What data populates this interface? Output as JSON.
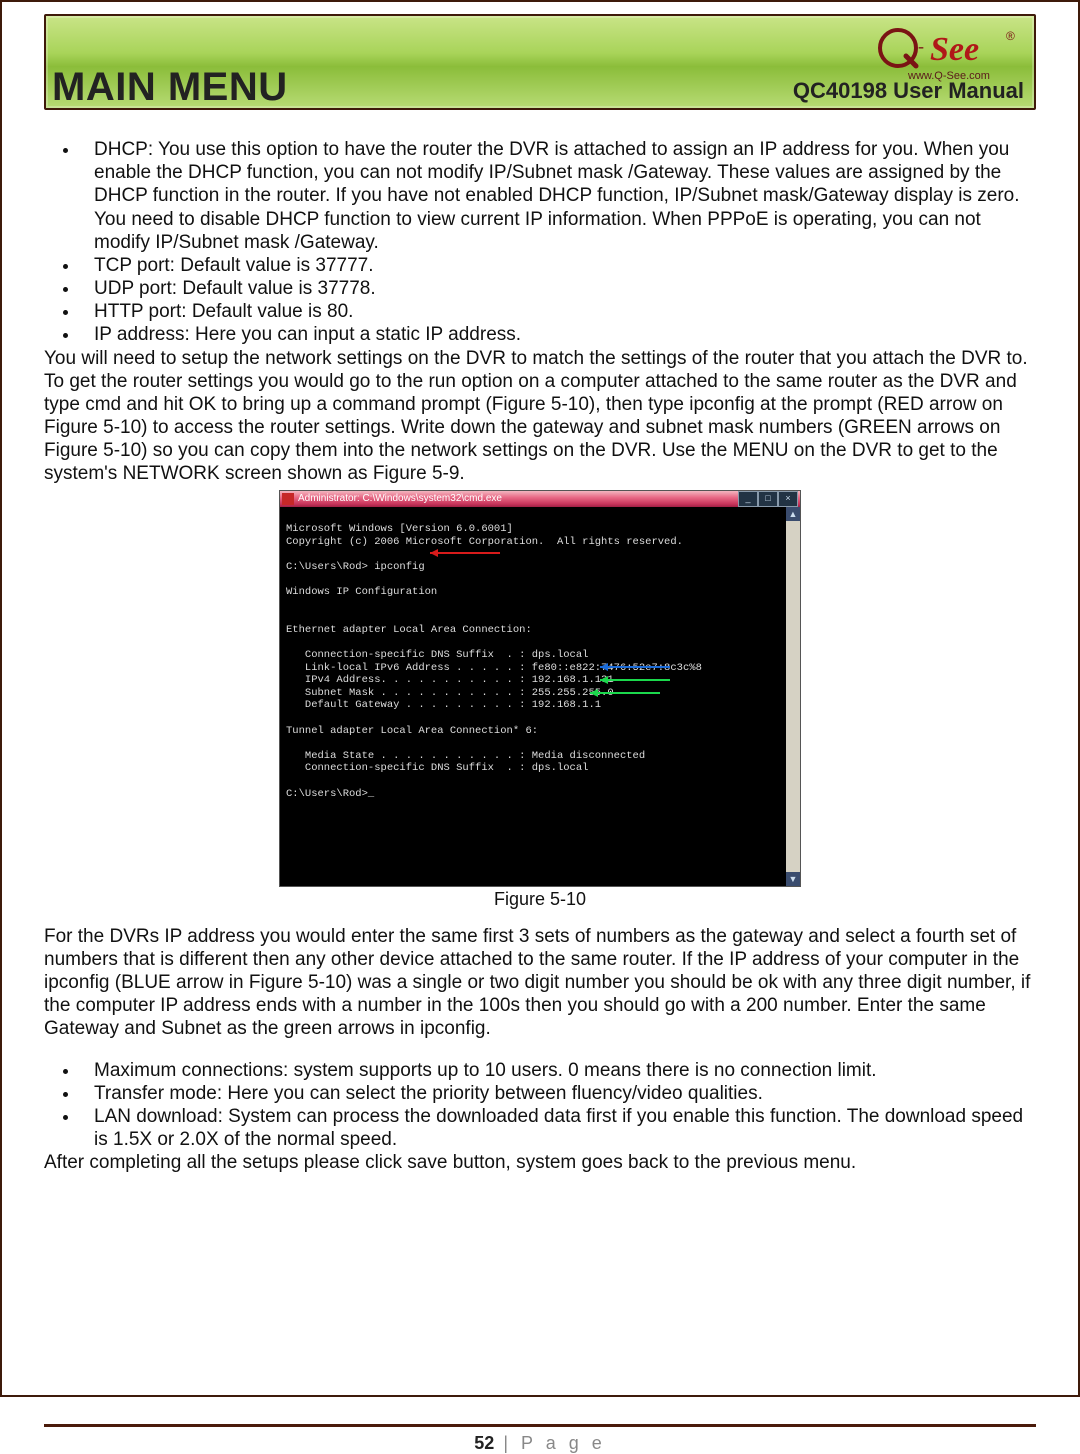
{
  "header": {
    "main_title": "MAIN MENU",
    "subtitle": "QC40198 User Manual",
    "logo_text": "Q-See",
    "logo_url": "www.Q-See.com"
  },
  "bullets1": [
    "DHCP: You use this option to have the router the DVR is attached to assign an IP address for you. When you enable the DHCP function, you can not modify IP/Subnet mask /Gateway. These values are assigned by the DHCP function in the router. If you have not enabled DHCP function, IP/Subnet mask/Gateway display is zero. You need to disable DHCP function to view current IP information.  When PPPoE is operating, you can not modify IP/Subnet mask /Gateway.",
    "TCP port: Default value is 37777.",
    "UDP port: Default value is 37778.",
    "HTTP port: Default value is 80.",
    "IP address: Here you can input a static IP address."
  ],
  "para1": "You will need to setup the network settings on the DVR to match the settings of the router that you attach the DVR to. To get the router settings you would go to the run option on a computer attached to the same router as the DVR and type cmd and hit OK to bring up a command prompt (Figure 5-10), then type ipconfig at the prompt (RED arrow on Figure 5-10) to access the router settings. Write down the gateway and subnet mask numbers (GREEN arrows on Figure 5-10) so you can copy them into the network settings on the DVR. Use the MENU on the DVR to get to the system's NETWORK screen shown as Figure 5-9.",
  "cmd": {
    "title": "Administrator: C:\\Windows\\system32\\cmd.exe",
    "lines": [
      "Microsoft Windows [Version 6.0.6001]",
      "Copyright (c) 2006 Microsoft Corporation.  All rights reserved.",
      "",
      "C:\\Users\\Rod> ipconfig",
      "",
      "Windows IP Configuration",
      "",
      "",
      "Ethernet adapter Local Area Connection:",
      "",
      "   Connection-specific DNS Suffix  . : dps.local",
      "   Link-local IPv6 Address . . . . . : fe80::e822:7476:52e7:8c3c%8",
      "   IPv4 Address. . . . . . . . . . . : 192.168.1.131",
      "   Subnet Mask . . . . . . . . . . . : 255.255.255.0",
      "   Default Gateway . . . . . . . . . : 192.168.1.1",
      "",
      "Tunnel adapter Local Area Connection* 6:",
      "",
      "   Media State . . . . . . . . . . . : Media disconnected",
      "   Connection-specific DNS Suffix  . : dps.local",
      "",
      "C:\\Users\\Rod>_"
    ]
  },
  "figure_caption": "Figure 5-10",
  "para2": "For the DVRs IP address you would enter the same first 3 sets of numbers as the gateway and select a fourth set of numbers that is different then any other device attached to the same router. If the IP address of your computer in the ipconfig (BLUE arrow in Figure 5-10) was a single or two digit number you should be ok with any three digit number, if the computer IP address ends with a number in the 100s then you should go with a 200 number. Enter the same Gateway and Subnet as the green arrows in ipconfig.",
  "bullets2": [
    "Maximum connections: system supports up to 10 users. 0 means there is no connection limit.",
    "Transfer mode: Here you can select the priority between fluency/video qualities.",
    "LAN download: System can process the downloaded data first if you enable this function. The download speed is 1.5X or 2.0X of the normal speed."
  ],
  "para3": "After completing all the setups please click save button, system goes back to the previous menu.",
  "footer": {
    "page_number": "52",
    "page_label": "P a g e"
  },
  "colors": {
    "arrow_red": "#d81b1b",
    "arrow_blue": "#1b6bd8",
    "arrow_green": "#1bd84c"
  }
}
